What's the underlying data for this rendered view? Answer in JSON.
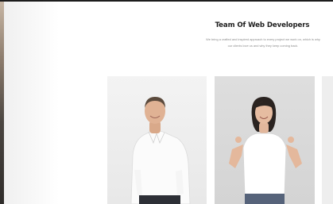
{
  "section": {
    "title": "Team Of Web Developers",
    "description_line1": "We bring a crafted and inspired approach to every project we work on, which is why",
    "description_line2": "our clients love us and why they keep coming back."
  },
  "team": [
    {
      "photo_icon": "man-white-shirt-portrait"
    },
    {
      "photo_icon": "woman-pointing-shirt-portrait"
    },
    {
      "photo_icon": "partial-card"
    }
  ],
  "colors": {
    "title": "#1e1e1e",
    "description": "#8d8d8d",
    "card_background": "#efefef"
  }
}
